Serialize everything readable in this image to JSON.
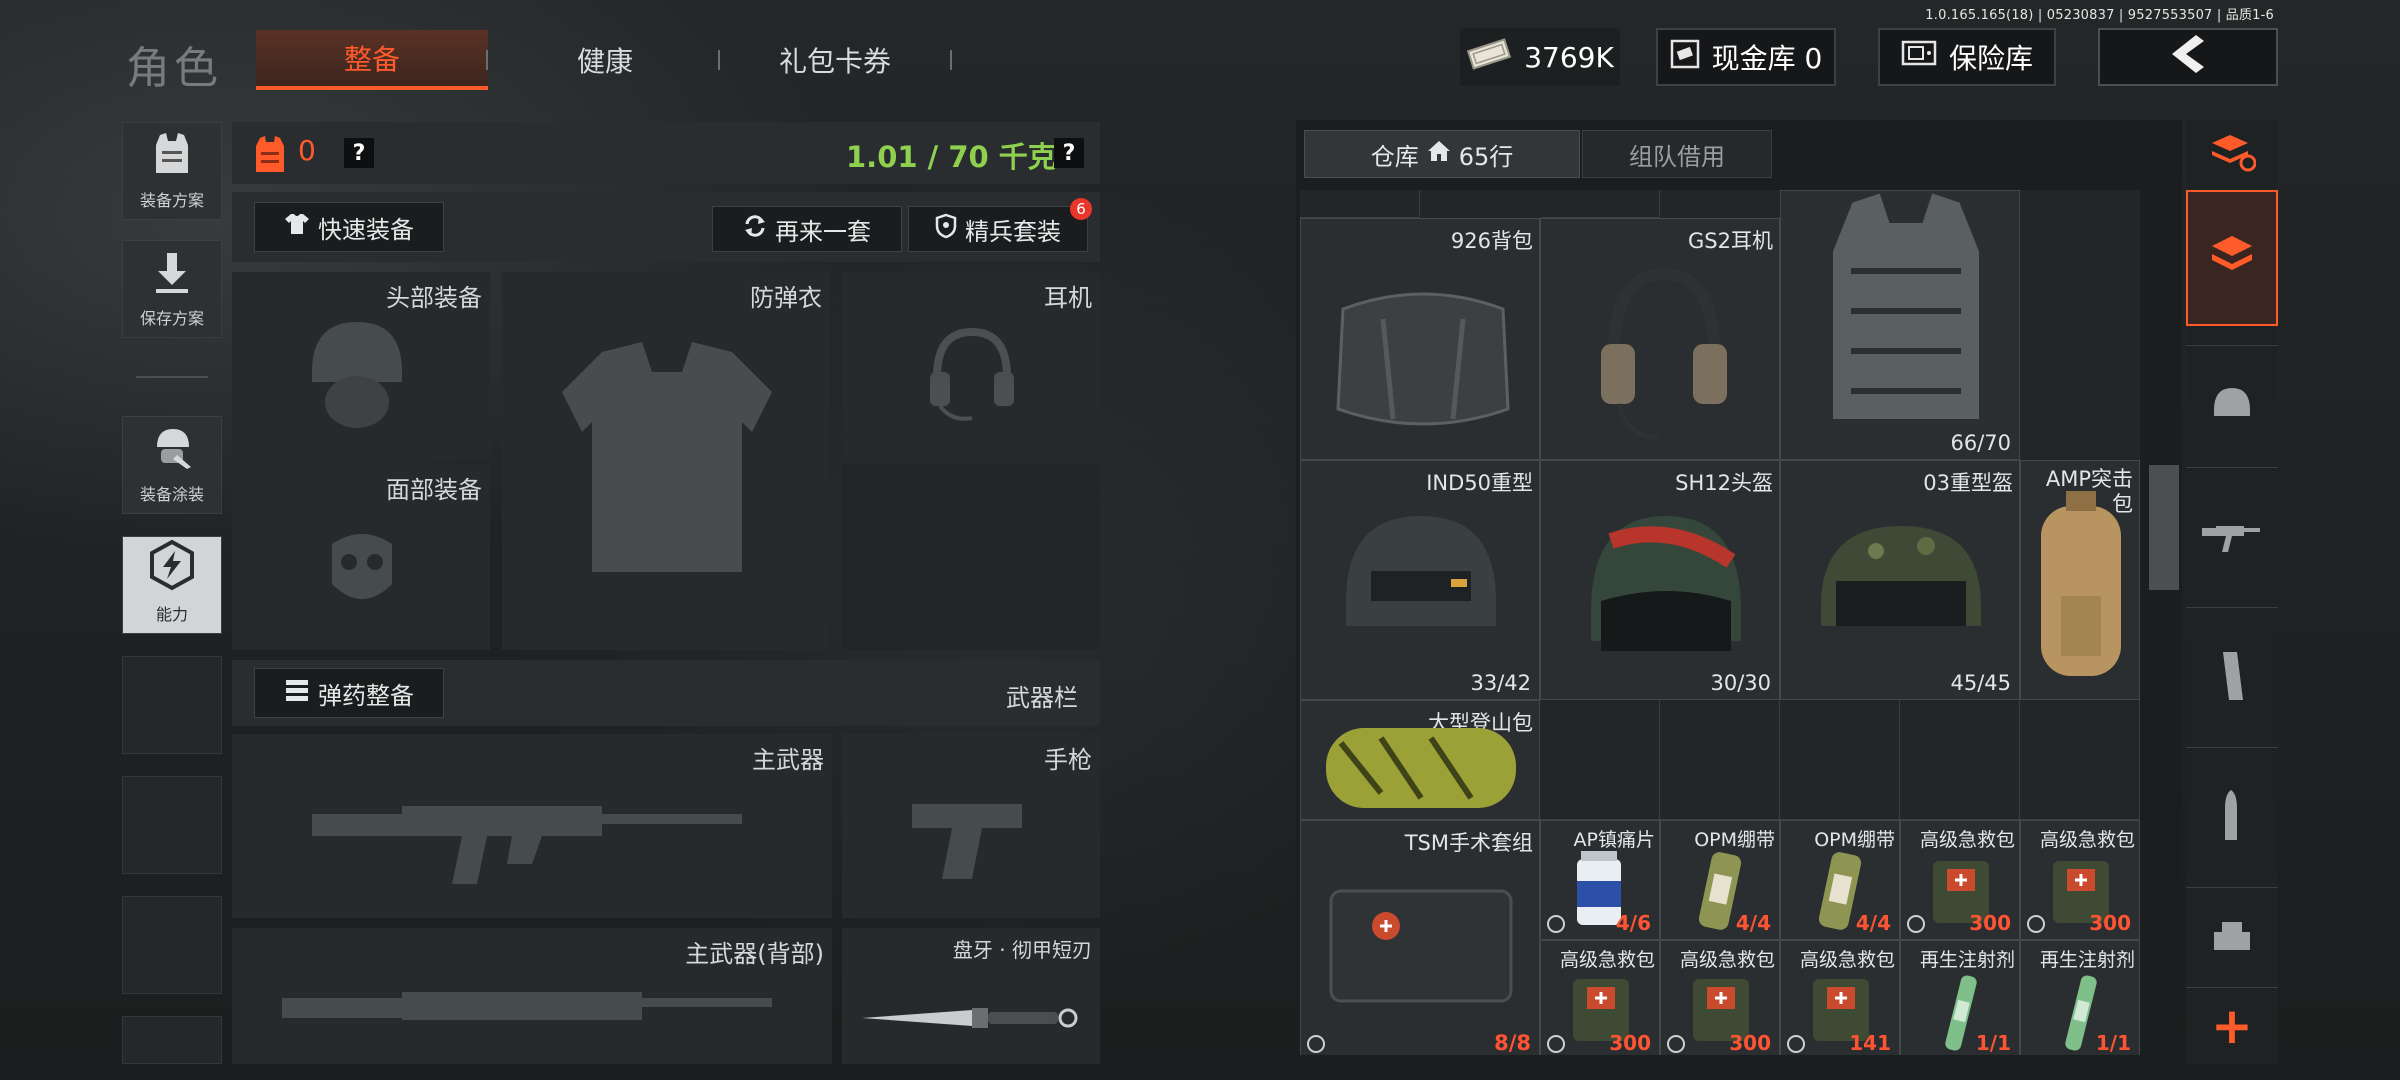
{
  "version": "1.0.165.165(18) | 05230837 | 9527553507 | 品质1-6",
  "header": {
    "title": "角色",
    "tabs": [
      {
        "label": "整备",
        "active": true
      },
      {
        "label": "健康",
        "active": false
      },
      {
        "label": "礼包卡券",
        "active": false
      }
    ],
    "money": "3769K",
    "cash_vault": "现金库 0",
    "safe_box": "保险库"
  },
  "sidebar": {
    "items": [
      {
        "label": "装备方案"
      },
      {
        "label": "保存方案"
      },
      {
        "label": "装备涂装"
      },
      {
        "label": "能力"
      }
    ]
  },
  "loadout": {
    "armor_count": "0",
    "help": "?",
    "weight": "1.01 / 70 千克",
    "quick_equip": "快速装备",
    "reroll": "再来一套",
    "elite_set": "精兵套装",
    "elite_badge": "6",
    "slots": {
      "head": "头部装备",
      "vest": "防弹衣",
      "headset": "耳机",
      "face": "面部装备"
    },
    "ammo_button": "弹药整备",
    "weapon_bar": "武器栏",
    "weapon_slots": {
      "primary": "主武器",
      "pistol": "手枪",
      "primary_back": "主武器(背部)",
      "melee": "盘牙 · 彻甲短刃"
    }
  },
  "storage": {
    "tabs": [
      {
        "label": "仓库",
        "rows": "65行",
        "active": true
      },
      {
        "label": "组队借用",
        "active": false
      }
    ],
    "items": {
      "backpack926": {
        "name": "926背包"
      },
      "gs2": {
        "name": "GS2耳机"
      },
      "vest": {
        "count": "66/70"
      },
      "ind50": {
        "name": "IND50重型",
        "count": "33/42"
      },
      "sh12": {
        "name": "SH12头盔",
        "count": "30/30"
      },
      "h03": {
        "name": "03重型盔",
        "count": "45/45"
      },
      "amp": {
        "name": "AMP突击\n包"
      },
      "mountain": {
        "name": "大型登山包"
      },
      "tsm": {
        "name": "TSM手术套组",
        "count": "8/8"
      },
      "apt": {
        "name": "AP镇痛片",
        "count": "4/6"
      },
      "opm1": {
        "name": "OPM绷带",
        "count": "4/4"
      },
      "opm2": {
        "name": "OPM绷带",
        "count": "4/4"
      },
      "firstaid1": {
        "name": "高级急救包",
        "count": "300"
      },
      "firstaid2": {
        "name": "高级急救包",
        "count": "300"
      },
      "firstaid3": {
        "name": "高级急救包",
        "count": "300"
      },
      "firstaid4": {
        "name": "高级急救包",
        "count": "300"
      },
      "firstaid5": {
        "name": "高级急救包",
        "count": "141"
      },
      "regen1": {
        "name": "再生注射剂",
        "count": "1/1"
      },
      "regen2": {
        "name": "再生注射剂",
        "count": "1/1"
      }
    }
  },
  "rail": {
    "add": "+"
  },
  "colors": {
    "accent": "#ff5a2a",
    "weight_green": "#8fd14f",
    "count_red": "#ff5433"
  }
}
